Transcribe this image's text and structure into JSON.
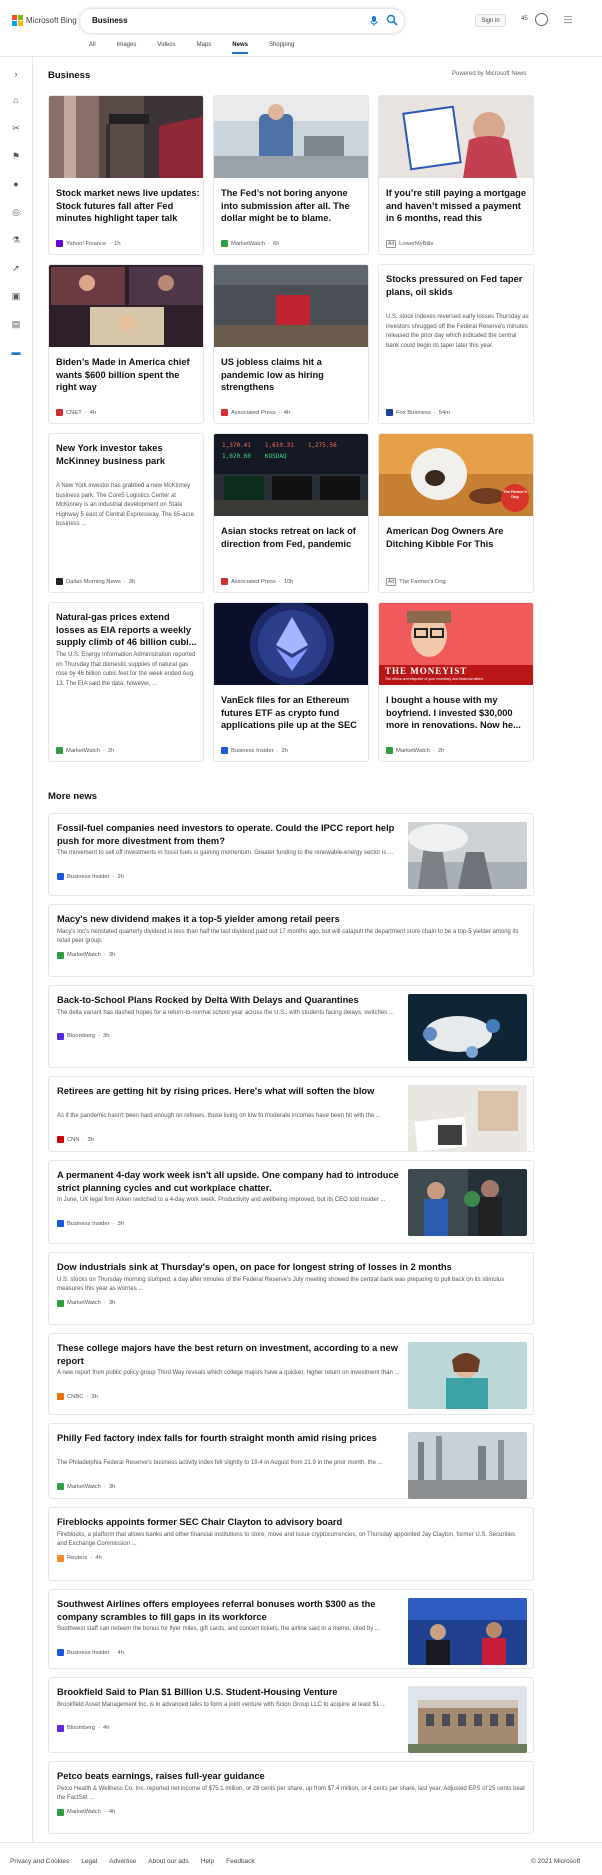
{
  "header": {
    "brand": "Microsoft Bing",
    "query": "Business",
    "signin": "Sign in",
    "rewards": "45",
    "tabs": [
      "All",
      "Images",
      "Videos",
      "Maps",
      "News",
      "Shopping"
    ],
    "active_tab": "News"
  },
  "section": {
    "title": "Business",
    "powered": "Powered by Microsoft News"
  },
  "cards": [
    {
      "title": "Stock market news live updates: Stock futures fall after Fed minutes highlight taper talk",
      "source": "Yahoo! Finance",
      "age": "1h",
      "icon": "yahoo-icon",
      "iconColor": "#6001d2",
      "image": "wall-street-sign"
    },
    {
      "title": "The Fed’s not boring anyone into submission after all. The dollar might be to blame.",
      "source": "MarketWatch",
      "age": "6h",
      "icon": "marketwatch-icon",
      "iconColor": "#2f9e44",
      "image": "trading-floor"
    },
    {
      "title": "If you’re still paying a mortgage and haven’t missed a payment in 6 months, read this",
      "ad": "Ad",
      "source": "LowerMyBills",
      "image": "paid-in-full-sign"
    },
    {
      "title": "Biden’s Made in America chief wants $600 billion spent the right way",
      "source": "CNET",
      "age": "4h",
      "icon": "cnet-icon",
      "iconColor": "#d32f2f",
      "image": "video-call-panel"
    },
    {
      "title": "US jobless claims hit a pandemic low as hiring strengthens",
      "source": "Associated Press",
      "age": "4h",
      "icon": "ap-icon",
      "iconColor": "#d32f2f",
      "image": "now-hiring-sign"
    },
    {
      "title": "Stocks pressured on Fed taper plans, oil skids",
      "desc": "U.S. stock indexes reversed early losses Thursday as investors shrugged off the Federal Reserve’s minutes released the prior day which indicated the central bank could begin its taper later this year.",
      "source": "Fox Business",
      "age": "54m",
      "icon": "fox-icon",
      "iconColor": "#1c3f94"
    },
    {
      "title": "New York investor takes McKinney business park",
      "desc": "A New York investor has grabbed a new McKinney business park. The Core5 Logistics Center at McKinney is an industrial development on State Highway 5 east of Central Expressway. The 65-acre business ...",
      "source": "Dallas Morning News",
      "age": "3h",
      "icon": "dmn-icon",
      "iconColor": "#222"
    },
    {
      "title": "Asian stocks retreat on lack of direction from Fed, pandemic",
      "source": "Associated Press",
      "age": "10h",
      "icon": "ap-icon",
      "iconColor": "#d32f2f",
      "image": "stock-tickers",
      "tickers": [
        "1,370.41",
        "1,610.31",
        "1,275.56",
        "1,020.60",
        "KOSDAQ"
      ]
    },
    {
      "title": "American Dog Owners Are Ditching Kibble For This",
      "ad": "Ad",
      "source": "The Farmer's Dog",
      "image": "dog-with-bowl",
      "badge": "The Farmer's Dog"
    },
    {
      "title": "Natural-gas prices extend losses as EIA reports a weekly supply climb of 46 billion cubi...",
      "desc": "The U.S. Energy Information Administration reported on Thursday that domestic supplies of natural gas rose by 46 billion cubic feet for the week ended Aug. 13. The EIA said the data, however, ...",
      "source": "MarketWatch",
      "age": "2h",
      "icon": "marketwatch-icon",
      "iconColor": "#2f9e44"
    },
    {
      "title": "VanEck files for an Ethereum futures ETF as crypto fund applications pile up at the SEC",
      "source": "Business Insider",
      "age": "2h",
      "icon": "bi-icon",
      "iconColor": "#1a5adb",
      "image": "ethereum-coin"
    },
    {
      "title": "I bought a house with my boyfriend. I invested $30,000 more in renovations. Now he...",
      "source": "MarketWatch",
      "age": "2h",
      "icon": "marketwatch-icon",
      "iconColor": "#2f9e44",
      "image": "moneyist-banner",
      "banner": "THE MONEYIST",
      "banner_sub": "The ethics and etiquette of your monetary and financial affairs"
    }
  ],
  "more": {
    "title": "More news",
    "items": [
      {
        "title": "Fossil-fuel companies need investors to operate. Could the IPCC report help push for more divestment from them?",
        "desc": "The movement to sell off investments in fossil fuels is gaining momentum. Greater funding to the renewable-energy sector is ...",
        "source": "Business Insider",
        "age": "2h",
        "icon": "bi-icon",
        "iconColor": "#1a5adb",
        "thumb": "power-plant"
      },
      {
        "title": "Macy's new dividend makes it a top-5 yielder among retail peers",
        "desc": "Macy's Inc's reinstated quarterly dividend is less than half the last dividend paid out 17 months ago, but will catapult the department store chain to be a top-5 yielder among its retail peer group.",
        "source": "MarketWatch",
        "age": "3h",
        "icon": "marketwatch-icon",
        "iconColor": "#2f9e44"
      },
      {
        "title": "Back-to-School Plans Rocked by Delta With Delays and Quarantines",
        "desc": "The delta variant has dashed hopes for a return-to-normal school year across the U.S., with students facing delays, switches ...",
        "source": "Bloomberg",
        "age": "3h",
        "icon": "bloomberg-icon",
        "iconColor": "#5b2ae0",
        "thumb": "classroom"
      },
      {
        "title": "Retirees are getting hit by rising prices. Here's what will soften the blow",
        "desc": "As if the pandemic hasn't been hard enough on retirees, those living on low to moderate incomes have been hit with the ...",
        "source": "CNN",
        "age": "3h",
        "icon": "cnn-icon",
        "iconColor": "#cc0000",
        "thumb": "calculator-paperwork"
      },
      {
        "title": "A permanent 4-day work week isn't all upside. One company had to introduce strict planning cycles and cut workplace chatter.",
        "desc": "In June, UK legal firm Arken switched to a 4-day work week. Productivity and wellbeing improved, but its CEO told Insider ...",
        "source": "Business Insider",
        "age": "3h",
        "icon": "bi-icon",
        "iconColor": "#1a5adb",
        "thumb": "office-workers"
      },
      {
        "title": "Dow industrials sink at Thursday's open, on pace for longest string of losses in 2 months",
        "desc": "U.S. stocks on Thursday morning slumped, a day after minutes of the Federal Reserve's July meeting showed the central bank was preparing to pull back on its stimulus measures this year as worries ...",
        "source": "MarketWatch",
        "age": "3h",
        "icon": "marketwatch-icon",
        "iconColor": "#2f9e44"
      },
      {
        "title": "These college majors have the best return on investment, according to a new report",
        "desc": "A new report from public policy group Third Way reveals which college majors have a quicker, higher return on investment than ...",
        "source": "CNBC",
        "age": "3h",
        "icon": "cnbc-icon",
        "iconColor": "#e8710a",
        "thumb": "student-phone"
      },
      {
        "title": "Philly Fed factory index falls for fourth straight month amid rising prices",
        "desc": "The Philadelphia Federal Reserve's business activity index fell slightly to 19.4 in August from 21.9 in the prior month, the ...",
        "source": "MarketWatch",
        "age": "3h",
        "icon": "marketwatch-icon",
        "iconColor": "#2f9e44",
        "thumb": "factory"
      },
      {
        "title": "Fireblocks appoints former SEC Chair Clayton to advisory board",
        "desc": "Fireblocks, a platform that allows banks and other financial institutions to store, move and issue cryptocurrencies, on Thursday appointed Jay Clayton, former U.S. Securities and Exchange Commission ...",
        "source": "Reuters",
        "age": "4h",
        "icon": "reuters-icon",
        "iconColor": "#f28c28"
      },
      {
        "title": "Southwest Airlines offers employees referral bonuses worth $300 as the company scrambles to fill gaps in its workforce",
        "desc": "Southwest staff can redeem the bonus for flyer miles, gift cards, and concert tickets, the airline said in a memo, cited by ...",
        "source": "Business Insider",
        "age": "4h",
        "icon": "bi-icon",
        "iconColor": "#1a5adb",
        "thumb": "airline-counter"
      },
      {
        "title": "Brookfield Said to Plan $1 Billion U.S. Student-Housing Venture",
        "desc": "Brookfield Asset Management Inc. is in advanced talks to form a joint venture with Scion Group LLC to acquire at least $1 ...",
        "source": "Bloomberg",
        "age": "4h",
        "icon": "bloomberg-icon",
        "iconColor": "#5b2ae0",
        "thumb": "campus-building"
      },
      {
        "title": "Petco beats earnings, raises full-year guidance",
        "desc": "Petco Health & Wellness Co. Inc. reported net income of $75.1 million, or 28 cents per share, up from $7.4 million, or 4 cents per share, last year. Adjusted EPS of 25 cents beat the FactSet ...",
        "source": "MarketWatch",
        "age": "4h",
        "icon": "marketwatch-icon",
        "iconColor": "#2f9e44"
      }
    ]
  },
  "footer": {
    "links": [
      "Privacy and Cookies",
      "Legal",
      "Advertise",
      "About our ads",
      "Help",
      "Feedback"
    ],
    "copyright": "© 2021 Microsoft"
  }
}
